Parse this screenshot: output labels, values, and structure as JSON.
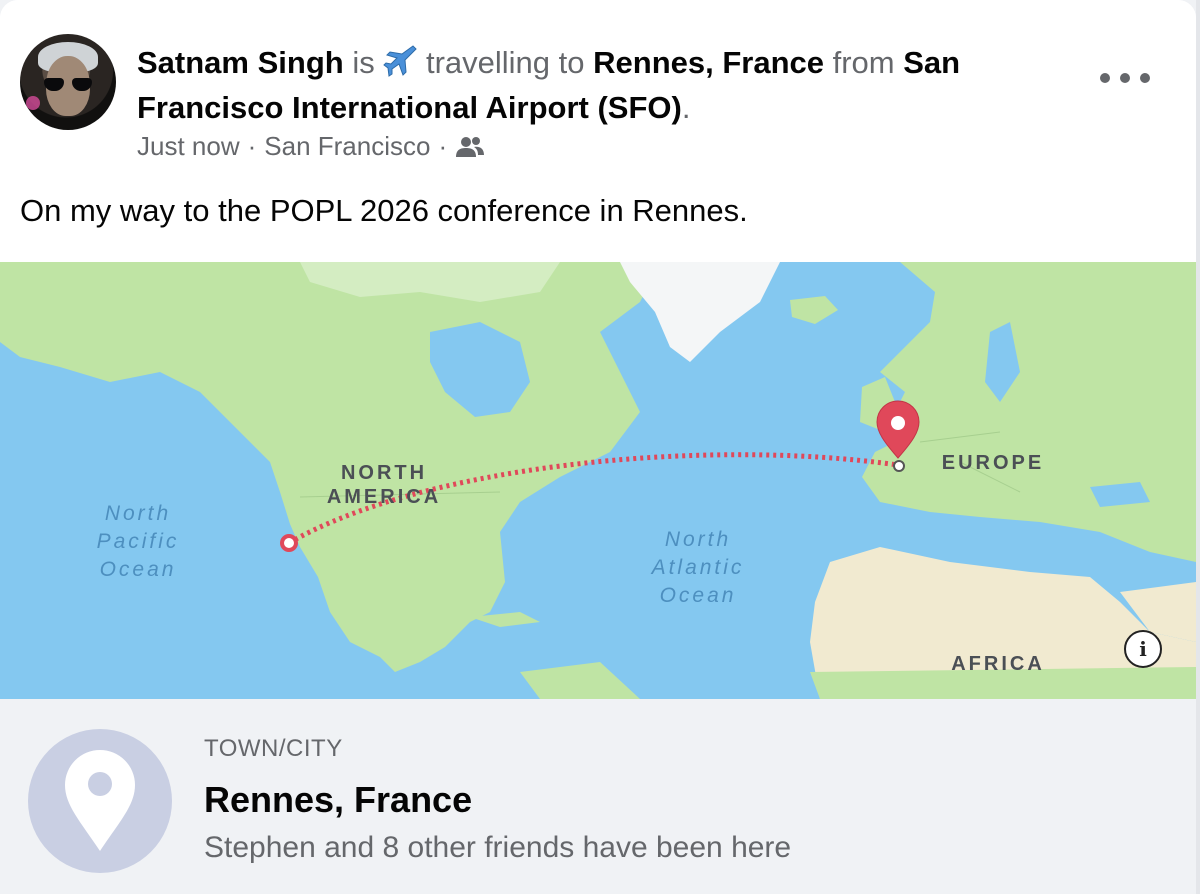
{
  "post": {
    "author": "Satnam Singh",
    "verb": "is",
    "activity": "travelling to",
    "destination": "Rennes, France",
    "from_word": "from",
    "origin": "San Francisco International Airport (SFO)",
    "end_punct": ".",
    "time": "Just now",
    "location": "San Francisco",
    "separator": "·",
    "audience_icon": "friends-icon",
    "more_icon": "more-options-icon",
    "text": "On my way to the POPL 2026 conference in Rennes."
  },
  "map": {
    "labels": {
      "north_america": "NORTH\nAMERICA",
      "europe": "EUROPE",
      "africa": "AFRICA",
      "north_pacific": "North\nPacific\nOcean",
      "north_atlantic": "North\nAtlantic\nOcean"
    },
    "route": {
      "from": "San Francisco",
      "to": "Rennes"
    },
    "colors": {
      "water": "#84c8f0",
      "land": "#bfe4a4",
      "ice": "#f4f6f7",
      "route": "#e0485a",
      "desert": "#f1ead0"
    },
    "info_label": "i"
  },
  "place": {
    "kind": "TOWN/CITY",
    "name": "Rennes, France",
    "friends": "Stephen and 8 other friends have been here",
    "icon": "location-pin-icon"
  }
}
